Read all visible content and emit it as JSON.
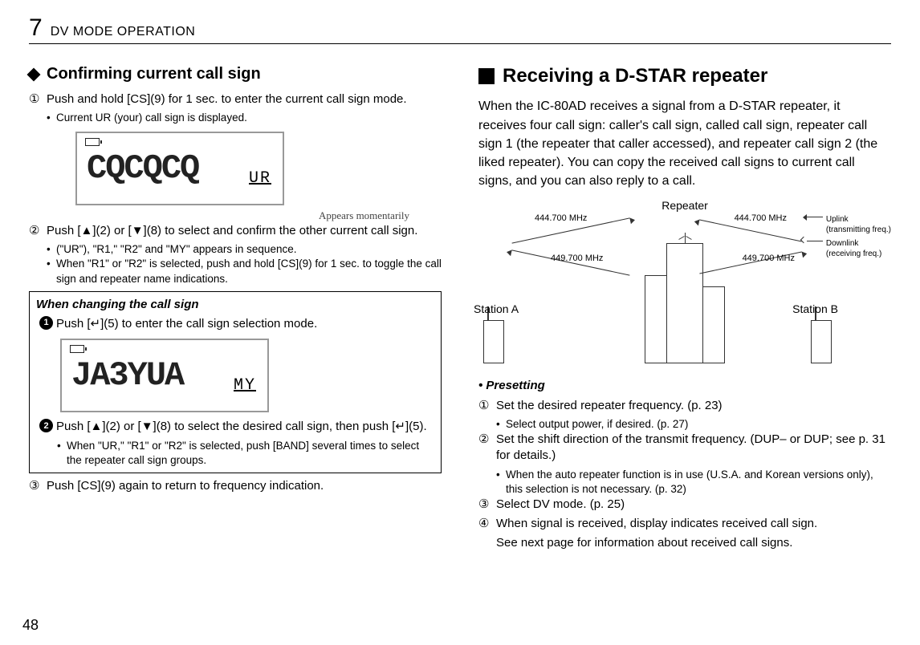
{
  "header": {
    "chapter_number": "7",
    "chapter_title": "DV MODE OPERATION"
  },
  "left": {
    "section_title": "Conﬁrming current call sign",
    "step1_num": "①",
    "step1": "Push and hold [CS](9) for 1 sec. to enter the current call sign mode.",
    "step1_b1": "Current UR (your) call sign is displayed.",
    "lcd1_main": "CQCQCQ",
    "lcd1_small": "UR",
    "lcd1_anno": "Appears momentarily",
    "step2_num": "②",
    "step2": "Push [▲](2) or [▼](8) to select and conﬁrm the other current call sign.",
    "step2_b1": "(\"UR\"), \"R1,\" \"R2\" and \"MY\" appears in sequence.",
    "step2_b2": "When \"R1\" or \"R2\" is selected, push and hold [CS](9) for 1 sec. to toggle the call sign and repeater name indications.",
    "box_title": "When changing the call sign",
    "box_s1": "Push [↵](5) to enter the call sign selection mode.",
    "lcd2_main": "JA3YUA",
    "lcd2_small": "MY",
    "box_s2": "Push [▲](2) or [▼](8) to select the desired call sign, then push [↵](5).",
    "box_b1": "When \"UR,\" \"R1\" or \"R2\" is selected, push [BAND] several times to select the repeater call sign groups.",
    "step3_num": "③",
    "step3": "Push [CS](9) again to return to frequency indication."
  },
  "right": {
    "section_title": "Receiving a D-STAR repeater",
    "intro": "When the IC-80AD receives a signal from a D-STAR repeater, it receives four call sign: caller's call sign, called call sign, repeater call sign 1 (the repeater that caller accessed), and repeater call sign 2 (the liked repeater). You can copy the received call signs to current call signs, and you can also reply to a call.",
    "diagram": {
      "repeater": "Repeater",
      "station_a": "Station A",
      "station_b": "Station B",
      "freq_up": "444.700 MHz",
      "freq_down": "449.700 MHz",
      "legend_up": "Uplink\n(transmitting freq.)",
      "legend_down": "Downlink\n(receiving freq.)"
    },
    "presetting_title": "• Presetting",
    "p1_num": "①",
    "p1": "Set the desired repeater frequency. (p. 23)",
    "p1_b1": "Select output power, if desired. (p. 27)",
    "p2_num": "②",
    "p2": "Set the shift direction of the transmit frequency. (DUP– or DUP; see p. 31 for details.)",
    "p2_b1": "When the auto repeater function is in use (U.S.A. and Korean versions only), this selection is not necessary. (p. 32)",
    "p3_num": "③",
    "p3": "Select DV mode. (p. 25)",
    "p4_num": "④",
    "p4": "When signal is received, display indicates received call sign.",
    "p4_cont": "See next page for information about received call signs."
  },
  "page_number": "48"
}
